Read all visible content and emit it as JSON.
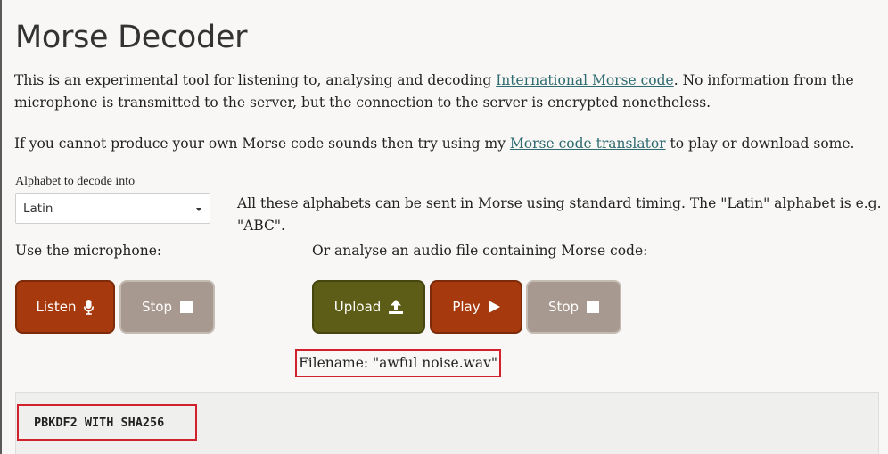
{
  "page": {
    "title": "Morse Decoder",
    "intro_before_link": "This is an experimental tool for listening to, analysing and decoding ",
    "intro_link": "International Morse code",
    "intro_after_link": ". No information from the microphone is transmitted to the server, but the connection to the server is encrypted nonetheless.",
    "translator_before_link": "If you cannot produce your own Morse code sounds then try using my ",
    "translator_link": "Morse code translator",
    "translator_after_link": " to play or download some."
  },
  "alphabet": {
    "label": "Alphabet to decode into",
    "selected": "Latin",
    "note": "All these alphabets can be sent in Morse using standard timing. The \"Latin\" alphabet is e.g. \"ABC\"."
  },
  "microphone": {
    "label": "Use the microphone:",
    "listen_label": "Listen",
    "stop_label": "Stop"
  },
  "audio_file": {
    "label": "Or analyse an audio file containing Morse code:",
    "upload_label": "Upload",
    "play_label": "Play",
    "stop_label": "Stop",
    "filename": "Filename: \"awful noise.wav\""
  },
  "output": {
    "text": "PBKDF2 WITH SHA256"
  },
  "colors": {
    "listen_button": "#a63a0e",
    "upload_button": "#5e5d17",
    "stop_button": "#a7998f",
    "highlight_box": "#d0212d",
    "link": "#2e6b70"
  },
  "icons": {
    "listen": "microphone-icon",
    "stop": "stop-square-icon",
    "upload": "upload-icon",
    "play": "play-icon"
  }
}
